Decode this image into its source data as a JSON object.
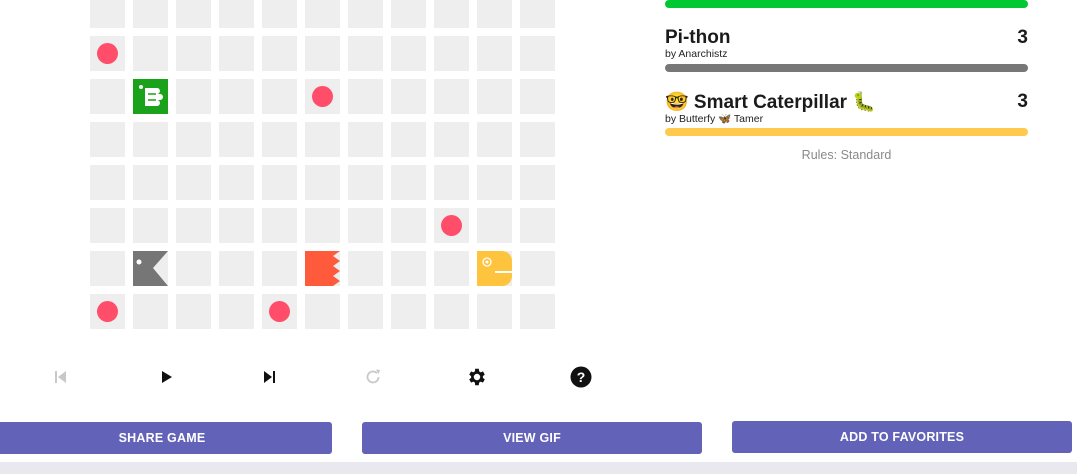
{
  "board": {
    "cols": 11,
    "rows": 8,
    "food": [
      [
        0,
        1
      ],
      [
        5,
        2
      ],
      [
        8,
        5
      ],
      [
        0,
        7
      ],
      [
        4,
        7
      ]
    ],
    "snakes": [
      {
        "id": "green",
        "color": "#1aa31a",
        "col": 1,
        "row": 2
      },
      {
        "id": "gray",
        "color": "#767676",
        "col": 1,
        "row": 6
      },
      {
        "id": "orange",
        "color": "#ff5a3c",
        "col": 5,
        "row": 6
      },
      {
        "id": "yellow",
        "color": "#ffc43d",
        "col": 9,
        "row": 6
      }
    ]
  },
  "controls": {
    "first_icon": "skip-to-first-icon",
    "play_icon": "play-icon",
    "next_icon": "skip-to-next-icon",
    "reload_icon": "reload-icon",
    "settings_icon": "gear-icon",
    "help_icon": "help-icon"
  },
  "buttons": {
    "share": "SHARE GAME",
    "gif": "VIEW GIF",
    "favorites": "ADD TO FAVORITES"
  },
  "scoreboard": {
    "entries": [
      {
        "name": "Pi-thon",
        "author": "by Anarchistz",
        "length": "3",
        "color": "#777777"
      },
      {
        "name": "🤓 Smart Caterpillar 🐛",
        "author": "by Butterfy 🦋 Tamer",
        "length": "3",
        "color": "#ffc94d"
      }
    ],
    "top_bar_color": "#00c732",
    "rules": "Rules: Standard"
  }
}
